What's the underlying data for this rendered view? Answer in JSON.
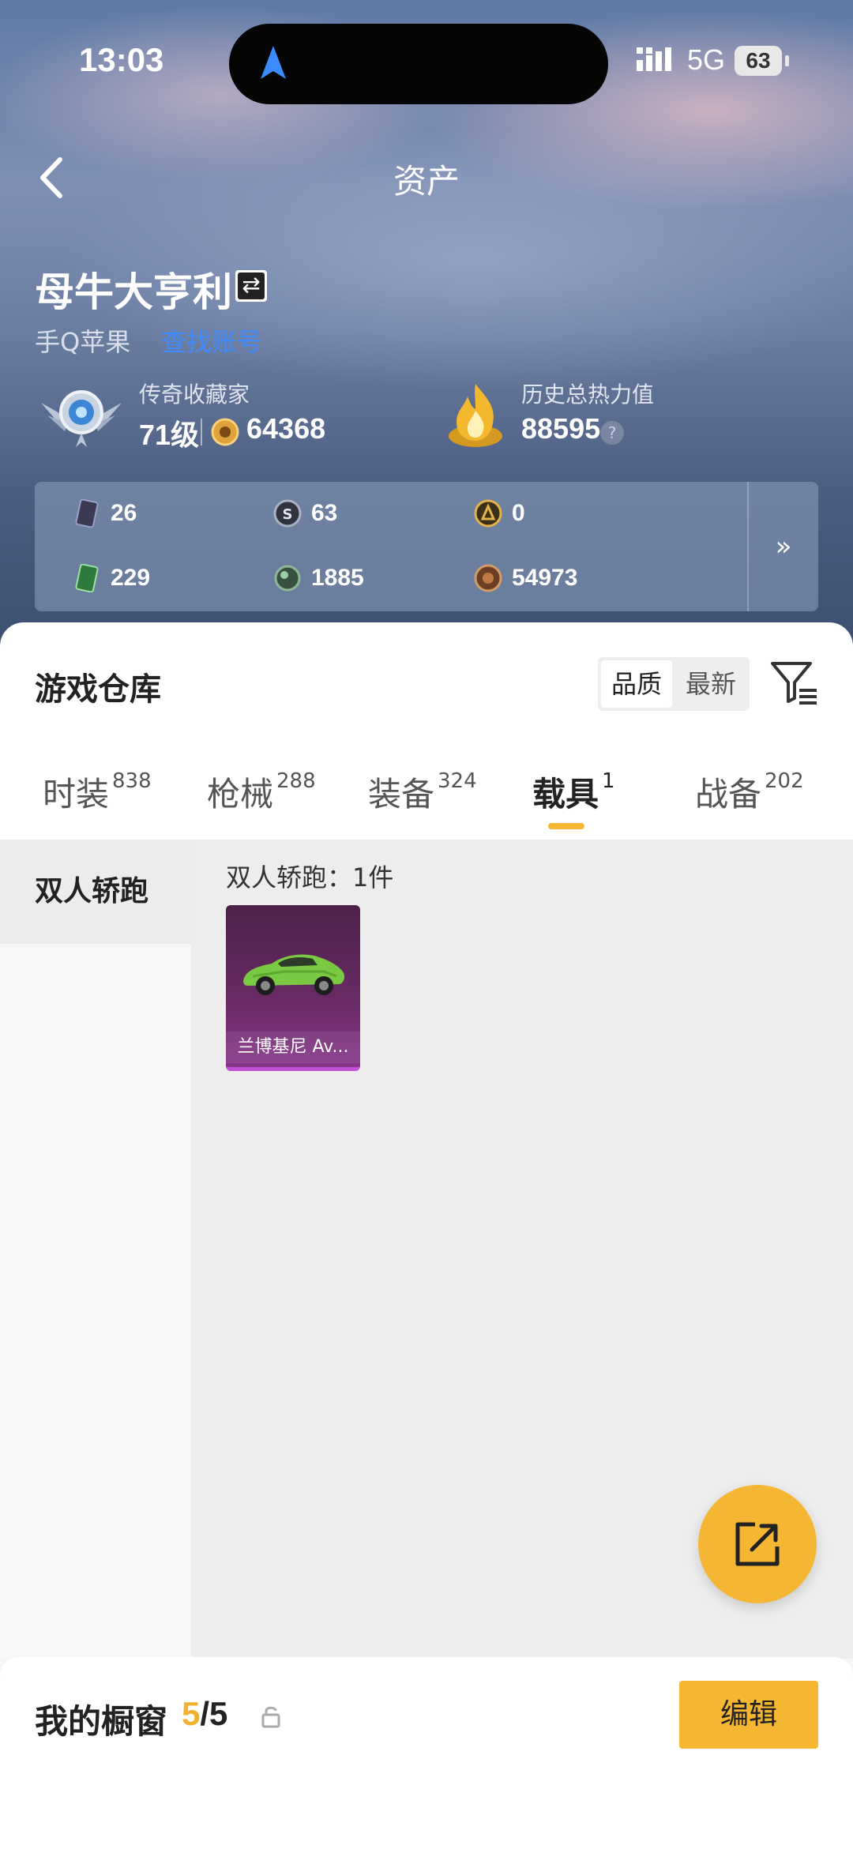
{
  "status_bar": {
    "time": "13:03",
    "network": "5G",
    "battery": "63"
  },
  "nav": {
    "title": "资产"
  },
  "profile": {
    "name": "母牛大亨利",
    "platform": "手Q苹果",
    "switch_link": "查找账号",
    "title_label": "传奇收藏家",
    "level": "71级",
    "points": "64368",
    "heat_label": "历史总热力值",
    "heat_value": "88595",
    "help": "?"
  },
  "currencies": [
    {
      "icon": "card-icon",
      "value": "26"
    },
    {
      "icon": "s-coin-icon",
      "value": "63"
    },
    {
      "icon": "gold-coin-icon",
      "value": "0"
    },
    {
      "icon": "green-card-icon",
      "value": "229"
    },
    {
      "icon": "green-orb-icon",
      "value": "1885"
    },
    {
      "icon": "bronze-coin-icon",
      "value": "54973"
    }
  ],
  "more": "»",
  "warehouse": {
    "title": "游戏仓库",
    "sort_options": [
      "品质",
      "最新"
    ],
    "sort_selected": "品质"
  },
  "tabs": [
    {
      "label": "时装",
      "count": "838"
    },
    {
      "label": "枪械",
      "count": "288"
    },
    {
      "label": "装备",
      "count": "324"
    },
    {
      "label": "载具",
      "count": "1"
    },
    {
      "label": "战备",
      "count": "202"
    }
  ],
  "active_tab": "载具",
  "sidebar": {
    "items": [
      "双人轿跑"
    ]
  },
  "content": {
    "category_label": "双人轿跑：1件",
    "items": [
      {
        "name": "兰博基尼 Av...",
        "quality_color": "#86348a"
      }
    ]
  },
  "showcase": {
    "label": "我的橱窗",
    "current": "5",
    "total": "/5",
    "edit_button": "编辑"
  },
  "colors": {
    "accent": "#f5b731",
    "link": "#3d8bff"
  }
}
